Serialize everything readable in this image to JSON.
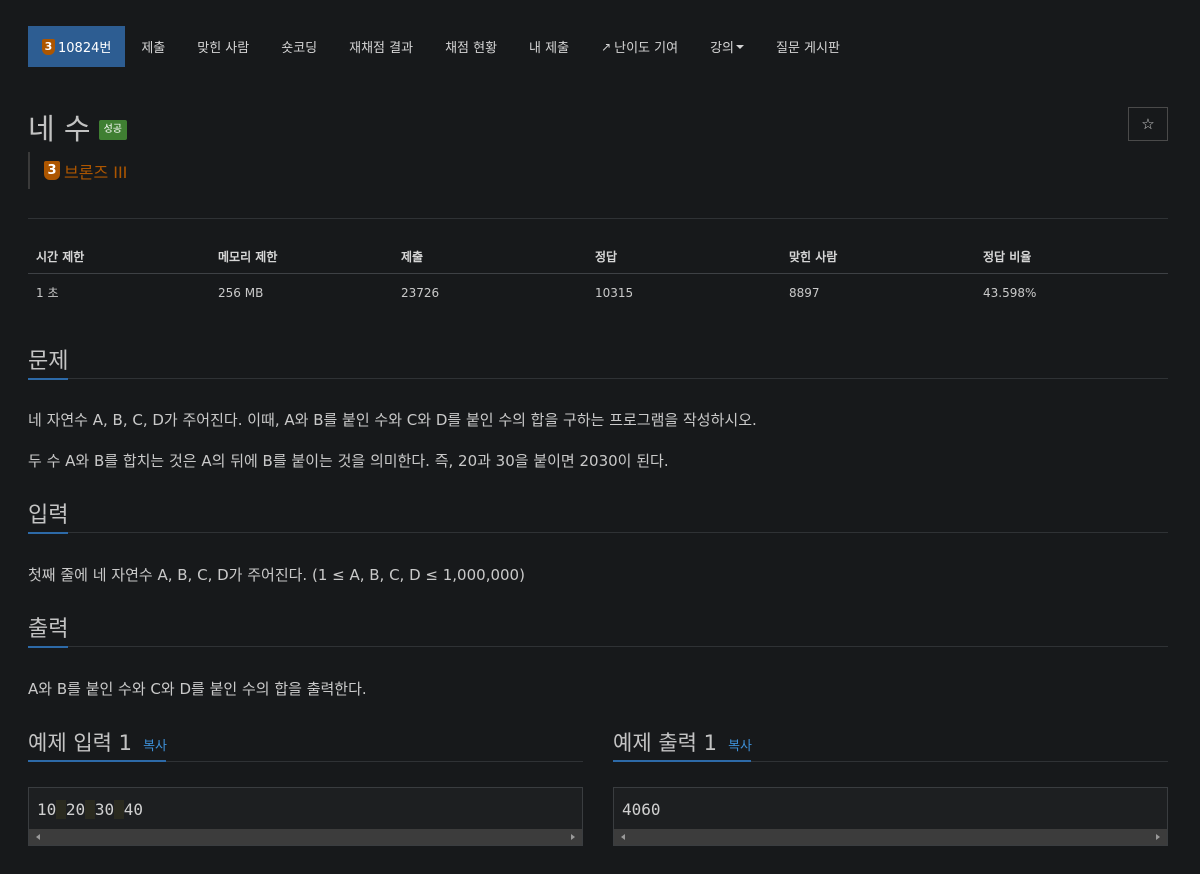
{
  "nav": {
    "problem_id_label": "10824번",
    "tier_digit": "3",
    "items": [
      "제출",
      "맞힌 사람",
      "숏코딩",
      "재채점 결과",
      "채점 현황",
      "내 제출",
      "난이도 기여",
      "강의",
      "질문 게시판"
    ]
  },
  "problem": {
    "title": "네 수",
    "result_badge": "성공",
    "tier_digit": "3",
    "tier_name": "브론즈 III",
    "star": "☆"
  },
  "stats": {
    "headers": [
      "시간 제한",
      "메모리 제한",
      "제출",
      "정답",
      "맞힌 사람",
      "정답 비율"
    ],
    "values": [
      "1 초",
      "256 MB",
      "23726",
      "10315",
      "8897",
      "43.598%"
    ]
  },
  "sections": {
    "problem_heading": "문제",
    "problem_lines": [
      "네 자연수 A, B, C, D가 주어진다. 이때, A와 B를 붙인 수와 C와 D를 붙인 수의 합을 구하는 프로그램을 작성하시오.",
      "두 수 A와 B를 합치는 것은 A의 뒤에 B를 붙이는 것을 의미한다. 즉, 20과 30을 붙이면 2030이 된다."
    ],
    "input_heading": "입력",
    "input_text": "첫째 줄에 네 자연수 A, B, C, D가 주어진다. (1 ≤ A, B, C, D ≤ 1,000,000)",
    "output_heading": "출력",
    "output_text": "A와 B를 붙인 수와 C와 D를 붙인 수의 합을 출력한다."
  },
  "examples": {
    "input_title": "예제 입력 1",
    "output_title": "예제 출력 1",
    "copy_label": "복사",
    "input_tokens": [
      "10",
      "20",
      "30",
      "40"
    ],
    "output_value": "4060"
  },
  "colors": {
    "accent": "#2d6aa8",
    "nav_active": "#2d5d92",
    "bronze": "#ad5600",
    "success": "#3f7f32",
    "copy_link": "#3d8fd6"
  }
}
